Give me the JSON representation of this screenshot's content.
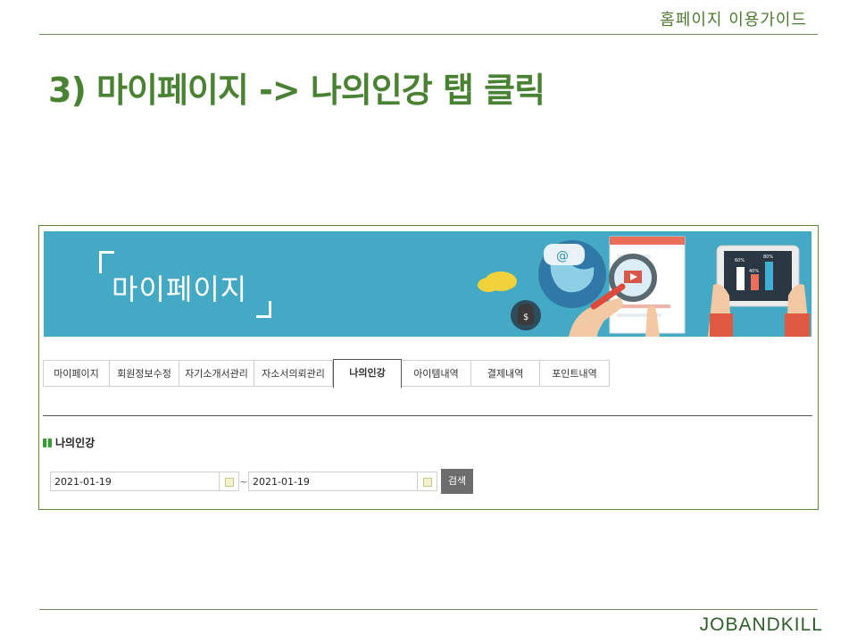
{
  "slide": {
    "guide_label": "홈페이지 이용가이드",
    "title": "3) 마이페이지 -> 나의인강 탭 클릭",
    "brand": "JOBANDKILL"
  },
  "banner": {
    "title": "마이페이지",
    "chart_labels": [
      "60%",
      "40%",
      "80%"
    ],
    "colors": {
      "background": "#43a9c4"
    }
  },
  "tabs": [
    {
      "label": "마이페이지",
      "active": false
    },
    {
      "label": "회원정보수정",
      "active": false
    },
    {
      "label": "자기소개서관리",
      "active": false
    },
    {
      "label": "자소서의뢰관리",
      "active": false
    },
    {
      "label": "나의인강",
      "active": true
    },
    {
      "label": "아이템내역",
      "active": false
    },
    {
      "label": "결제내역",
      "active": false
    },
    {
      "label": "포인트내역",
      "active": false
    }
  ],
  "section": {
    "title": "나의인강",
    "icon": "gift-icon"
  },
  "search": {
    "start_date": "2021-01-19",
    "separator": "~",
    "end_date": "2021-01-19",
    "button_label": "검색"
  },
  "colors": {
    "accent": "#4a8233",
    "rule": "#6e8f55"
  }
}
